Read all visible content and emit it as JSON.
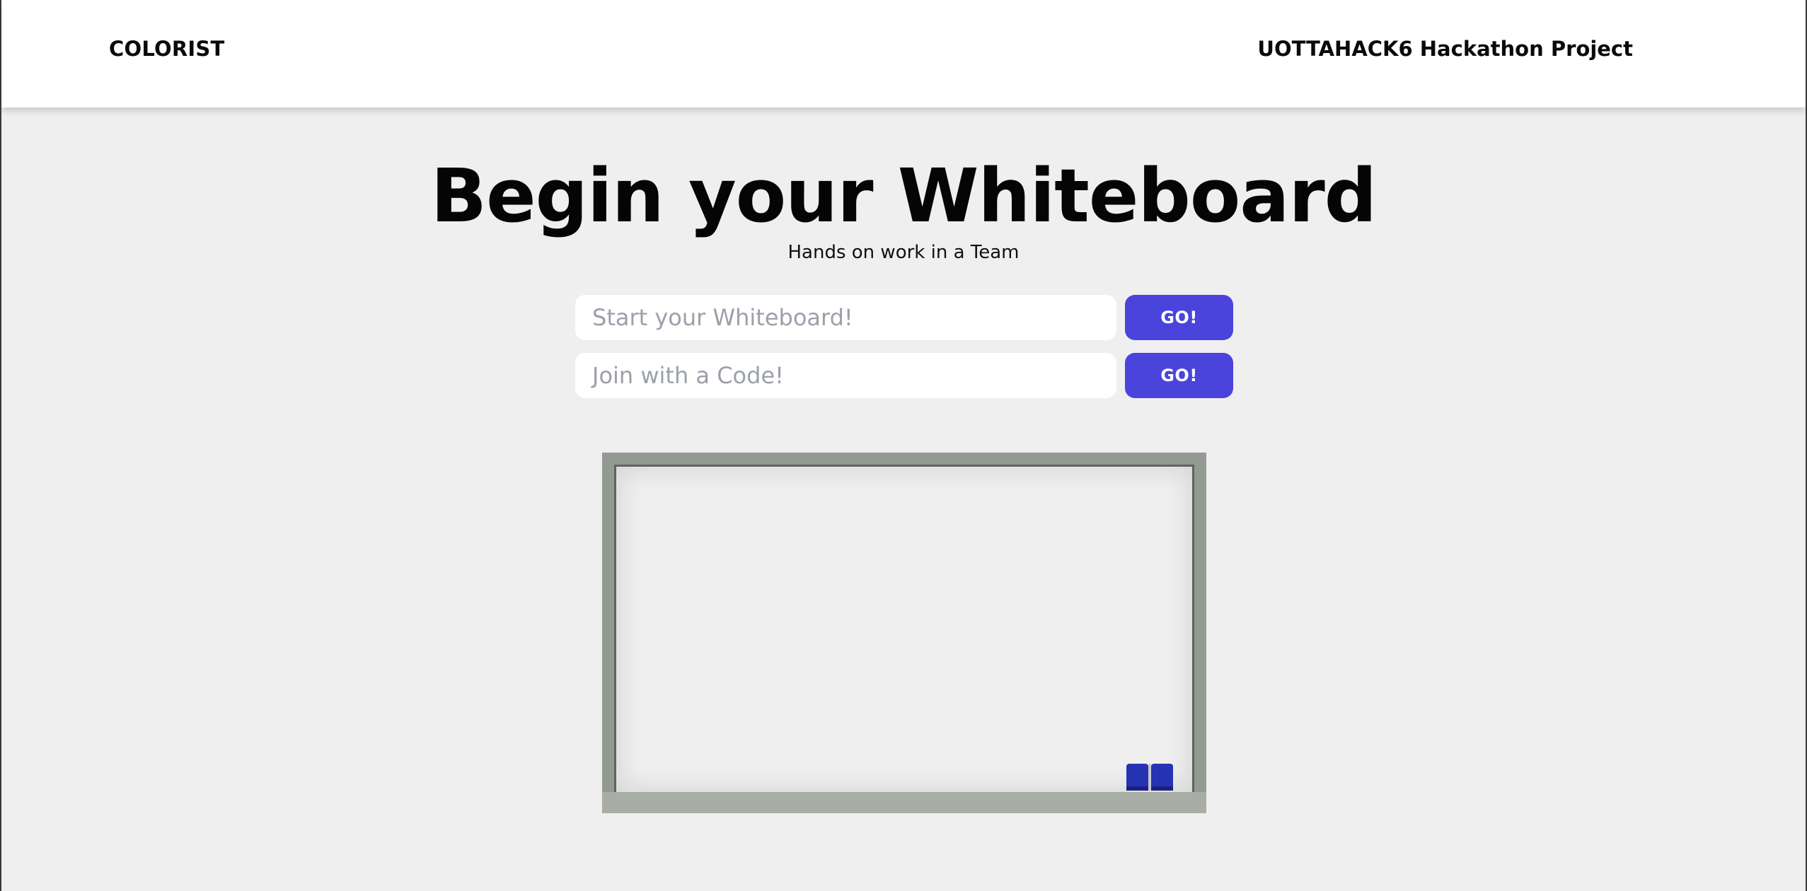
{
  "navbar": {
    "brand": "COLORIST",
    "project": "UOTTAHACK6 Hackathon Project"
  },
  "hero": {
    "title": "Begin your Whiteboard",
    "subtitle": "Hands on work in a Team"
  },
  "actions": {
    "start_placeholder": "Start your Whiteboard!",
    "start_button": "GO!",
    "join_placeholder": "Join with a Code!",
    "join_button": "GO!"
  },
  "colors": {
    "accent": "#4a43dc",
    "background": "#efeff0",
    "board_frame": "#939a92",
    "eraser": "#2633b3"
  }
}
